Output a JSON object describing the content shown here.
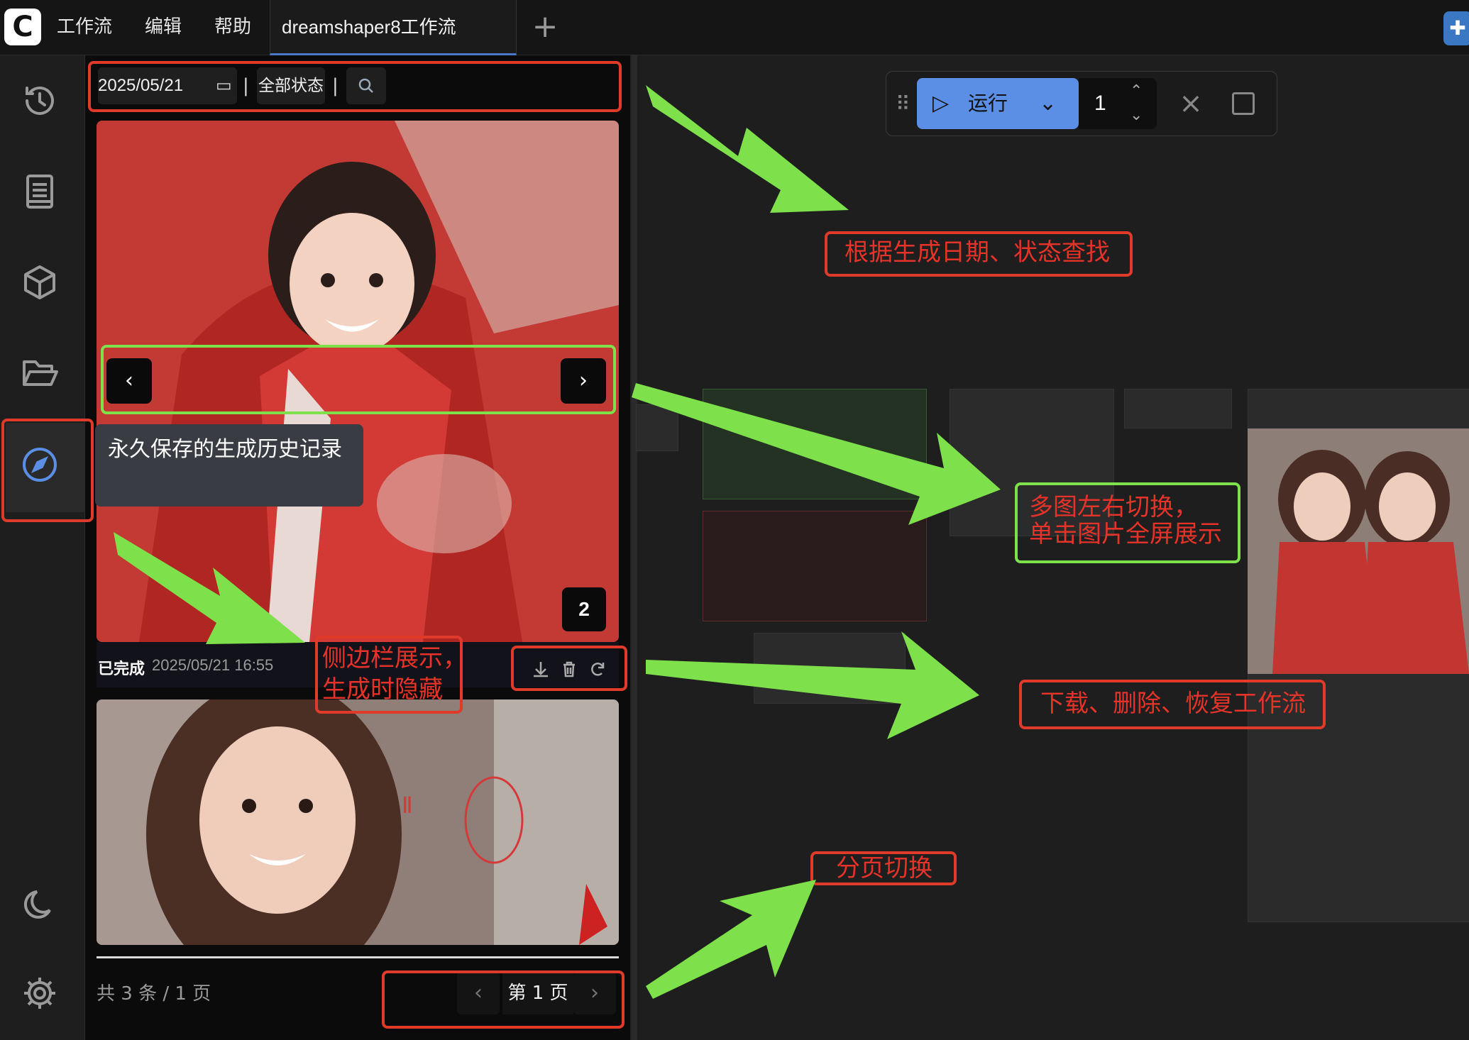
{
  "app": {
    "logo_letter": "C"
  },
  "menu": {
    "workflow": "工作流",
    "edit": "编辑",
    "help": "帮助"
  },
  "tabs": [
    {
      "label": "dreamshaper8工作流"
    }
  ],
  "filter": {
    "date": "2025/05/21",
    "status": "全部状态",
    "separator": "|"
  },
  "cards": [
    {
      "status": "已完成",
      "time": "2025/05/21 16:55",
      "image_count": "2"
    }
  ],
  "tooltip": {
    "text": "永久保存的生成历史记录"
  },
  "pagination": {
    "summary": "共 3 条 / 1 页",
    "current": "第 1 页"
  },
  "runbar": {
    "run_label": "运行",
    "quantity": "1"
  },
  "annotations": {
    "search": "根据生成日期、状态查找",
    "switch": "多图左右切换，\n单击图片全屏展示",
    "sidebar": "侧边栏展示，\n生成时隐藏",
    "actions": "下载、删除、恢复工作流",
    "paging": "分页切换"
  },
  "colors": {
    "accent": "#5b8fe6",
    "annotation_red": "#e03a2a",
    "annotation_green": "#7ee04a"
  }
}
